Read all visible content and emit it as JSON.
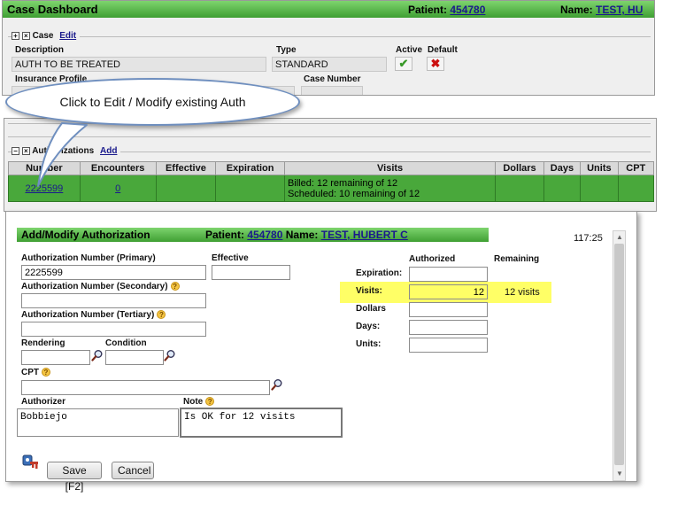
{
  "dashboard": {
    "title": "Case Dashboard",
    "patient_label": "Patient:",
    "patient_id": "454780",
    "name_label": "Name:",
    "name_value": "TEST, HU",
    "case_section": {
      "label": "Case",
      "edit_link": "Edit"
    },
    "description_label": "Description",
    "description_value": "AUTH TO BE TREATED",
    "type_label": "Type",
    "type_value": "STANDARD",
    "active_label": "Active",
    "default_label": "Default",
    "insurance_profile_label": "Insurance Profile",
    "case_number_label": "Case Number"
  },
  "callout": {
    "text": "Click to Edit / Modify existing Auth"
  },
  "authorizations": {
    "section_label": "Authorizations",
    "add_link": "Add",
    "columns": [
      "Number",
      "Encounters",
      "Effective",
      "Expiration",
      "Visits",
      "Dollars",
      "Days",
      "Units",
      "CPT"
    ],
    "row": {
      "number": "2225599",
      "encounters": "0",
      "effective": "",
      "expiration": "",
      "visits_line1": "Billed: 12 remaining of 12",
      "visits_line2": "Scheduled: 10 remaining of 12",
      "dollars": "",
      "days": "",
      "units": "",
      "cpt": ""
    }
  },
  "modal": {
    "title": "Add/Modify Authorization",
    "patient_label": "Patient:",
    "patient_id": "454780",
    "name_label": "Name:",
    "name_value": "TEST, HUBERT C",
    "timer": "117:25",
    "fields": {
      "auth_primary_label": "Authorization Number (Primary)",
      "auth_primary_value": "2225599",
      "effective_label": "Effective",
      "effective_value": "",
      "auth_secondary_label": "Authorization Number (Secondary)",
      "auth_secondary_value": "",
      "auth_tertiary_label": "Authorization Number (Tertiary)",
      "auth_tertiary_value": "",
      "rendering_label": "Rendering",
      "rendering_value": "",
      "condition_label": "Condition",
      "condition_value": "",
      "cpt_label": "CPT",
      "cpt_value": "",
      "authorizer_label": "Authorizer",
      "authorizer_value": "Bobbiejo",
      "note_label": "Note",
      "note_value": "Is OK for 12 visits"
    },
    "limits": {
      "authorized_header": "Authorized",
      "remaining_header": "Remaining",
      "expiration_label": "Expiration:",
      "expiration_value": "",
      "visits_label": "Visits:",
      "visits_value": "12",
      "visits_remaining": "12 visits",
      "dollars_label": "Dollars",
      "dollars_value": "",
      "days_label": "Days:",
      "days_value": "",
      "units_label": "Units:",
      "units_value": ""
    },
    "buttons": {
      "save": "Save [F2]",
      "cancel": "Cancel"
    }
  },
  "colors": {
    "green_bar": "#4caf3c",
    "row_green": "#49a83b",
    "highlight": "#ffff66",
    "callout_border": "#6f8fbf"
  }
}
